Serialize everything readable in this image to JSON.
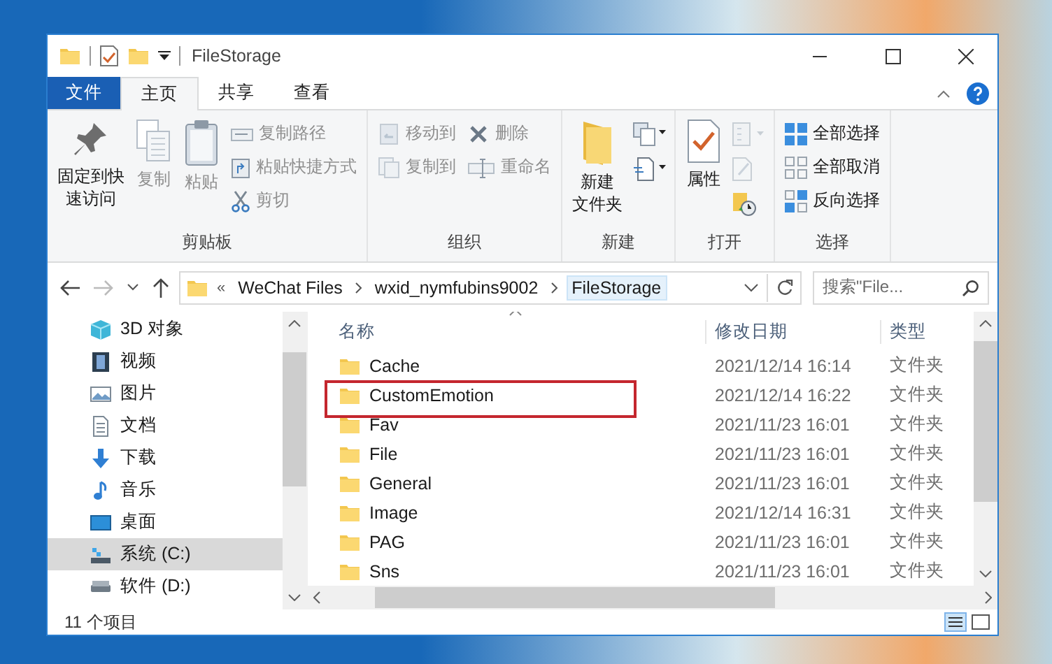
{
  "window": {
    "title": "FileStorage"
  },
  "tabs": [
    {
      "label": "文件",
      "kind": "file",
      "selected": false
    },
    {
      "label": "主页",
      "kind": "tab",
      "selected": true
    },
    {
      "label": "共享",
      "kind": "tab",
      "selected": false
    },
    {
      "label": "查看",
      "kind": "tab",
      "selected": false
    }
  ],
  "ribbon": [
    {
      "label": "剪贴板",
      "items": [
        {
          "kind": "large",
          "label": [
            "固定到快",
            "速访问"
          ],
          "disabled": false
        },
        {
          "kind": "large",
          "label": [
            "复制"
          ],
          "disabled": true
        },
        {
          "kind": "large",
          "label": [
            "粘贴"
          ],
          "disabled": true
        },
        {
          "kind": "small",
          "label": "复制路径",
          "disabled": true
        },
        {
          "kind": "small",
          "label": "粘贴快捷方式",
          "disabled": true
        },
        {
          "kind": "small",
          "label": "剪切",
          "disabled": true
        }
      ]
    },
    {
      "label": "组织",
      "items": [
        {
          "kind": "small",
          "label": "移动到",
          "disabled": true
        },
        {
          "kind": "small",
          "label": "复制到",
          "disabled": true
        },
        {
          "kind": "small",
          "label": "删除",
          "disabled": true
        },
        {
          "kind": "small",
          "label": "重命名",
          "disabled": true
        }
      ]
    },
    {
      "label": "新建",
      "items": [
        {
          "kind": "large",
          "label": [
            "新建",
            "文件夹"
          ],
          "disabled": false
        },
        {
          "kind": "icon",
          "disabled": false
        },
        {
          "kind": "icon",
          "disabled": false
        }
      ]
    },
    {
      "label": "打开",
      "items": [
        {
          "kind": "large",
          "label": [
            "属性"
          ],
          "disabled": false
        },
        {
          "kind": "icon",
          "disabled": true
        },
        {
          "kind": "icon",
          "disabled": true
        },
        {
          "kind": "icon",
          "disabled": false
        }
      ]
    },
    {
      "label": "选择",
      "items": [
        {
          "kind": "small",
          "label": "全部选择",
          "disabled": false
        },
        {
          "kind": "small",
          "label": "全部取消",
          "disabled": false
        },
        {
          "kind": "small",
          "label": "反向选择",
          "disabled": false
        }
      ]
    }
  ],
  "address": {
    "overflow": "«",
    "crumbs": [
      "WeChat Files",
      "wxid_nymfubins9002",
      "FileStorage"
    ],
    "search_placeholder": "搜索\"File..."
  },
  "sidebar": {
    "items": [
      {
        "label": "3D 对象",
        "selected": false
      },
      {
        "label": "视频",
        "selected": false
      },
      {
        "label": "图片",
        "selected": false
      },
      {
        "label": "文档",
        "selected": false
      },
      {
        "label": "下载",
        "selected": false
      },
      {
        "label": "音乐",
        "selected": false
      },
      {
        "label": "桌面",
        "selected": false
      },
      {
        "label": "系统 (C:)",
        "selected": true
      },
      {
        "label": "软件 (D:)",
        "selected": false
      }
    ]
  },
  "table": {
    "columns": [
      "名称",
      "修改日期",
      "类型"
    ],
    "rows": [
      {
        "name": "Cache",
        "modified": "2021/12/14 16:14",
        "type": "文件夹",
        "annotated": false
      },
      {
        "name": "CustomEmotion",
        "modified": "2021/12/14 16:22",
        "type": "文件夹",
        "annotated": true
      },
      {
        "name": "Fav",
        "modified": "2021/11/23 16:01",
        "type": "文件夹",
        "annotated": false
      },
      {
        "name": "File",
        "modified": "2021/11/23 16:01",
        "type": "文件夹",
        "annotated": false
      },
      {
        "name": "General",
        "modified": "2021/11/23 16:01",
        "type": "文件夹",
        "annotated": false
      },
      {
        "name": "Image",
        "modified": "2021/12/14 16:31",
        "type": "文件夹",
        "annotated": false
      },
      {
        "name": "PAG",
        "modified": "2021/11/23 16:01",
        "type": "文件夹",
        "annotated": false
      },
      {
        "name": "Sns",
        "modified": "2021/11/23 16:01",
        "type": "文件夹",
        "annotated": false
      }
    ]
  },
  "status_bar": {
    "count": "11 个项目"
  }
}
